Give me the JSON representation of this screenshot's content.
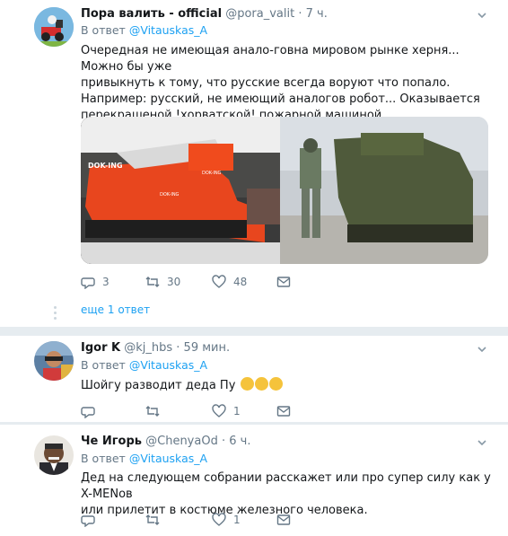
{
  "tweets": [
    {
      "name": "Пора валить - official",
      "handle": "@pora_valit",
      "time": "· 7 ч.",
      "reply_prefix": "В ответ",
      "reply_to": "@Vitauskas_A",
      "text_lines": [
        "Очередная не имеющая анало-говна мировом рынке херня... Можно бы уже",
        "привыкнуть к тому, что русские всегда воруют что попало.",
        "Например: русский, не имеющий аналогов робот... Оказывается",
        "перекрашеной !хорватской! пожарной машиной."
      ],
      "media": {
        "left_logo": "DOK-ING",
        "left_logo2": "DOK-ING",
        "left_side": "DOK-ING"
      },
      "counts": {
        "replies": "3",
        "retweets": "30",
        "likes": "48"
      },
      "more_replies": "еще 1 ответ"
    },
    {
      "name": "Igor K",
      "handle": "@kj_hbs",
      "time": "· 59 мин.",
      "reply_prefix": "В ответ",
      "reply_to": "@Vitauskas_A",
      "text": "Шойгу разводит деда Пу",
      "counts": {
        "replies": "",
        "retweets": "",
        "likes": "1"
      }
    },
    {
      "name": "Че Игорь",
      "handle": "@ChenyaOd",
      "time": "· 6 ч.",
      "reply_prefix": "В ответ",
      "reply_to": "@Vitauskas_A",
      "text_lines": [
        "Дед на следующем собрании расскажет или про супер силу как у X-MENов",
        "или прилетит в костюме железного человека."
      ],
      "counts": {
        "replies": "",
        "retweets": "",
        "likes": "1"
      }
    }
  ],
  "icons": {
    "reply": "reply-icon",
    "retweet": "retweet-icon",
    "like": "like-icon",
    "dm": "direct-message-icon",
    "chevron": "chevron-down-icon"
  },
  "colors": {
    "accent": "#1da1f2",
    "muted": "#657786",
    "separator": "#e6ecf0"
  }
}
